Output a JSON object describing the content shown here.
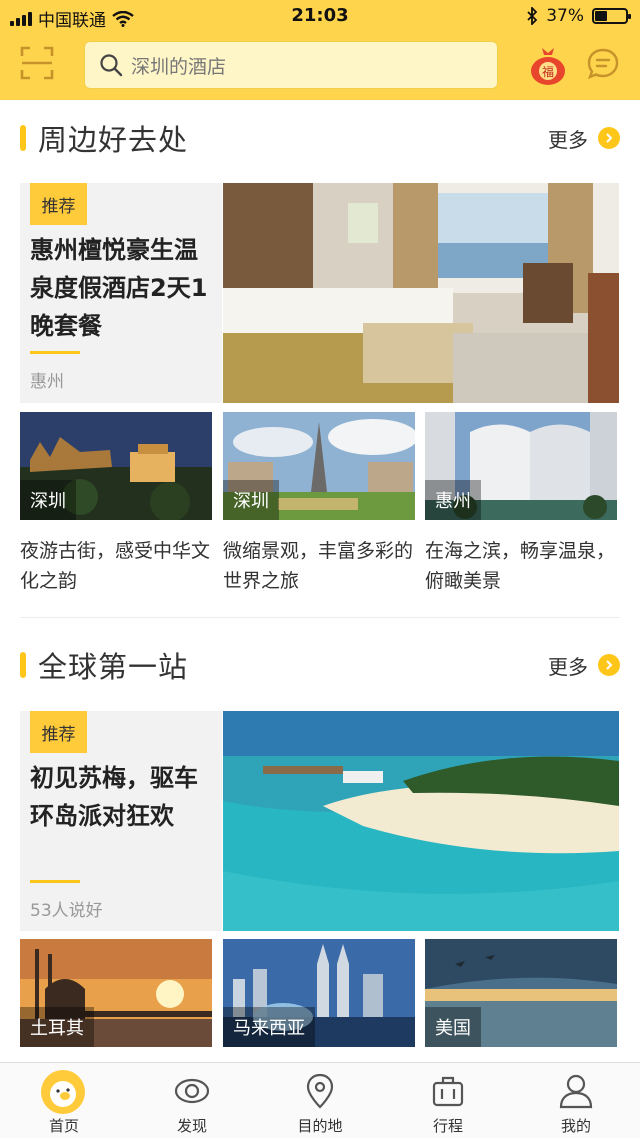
{
  "status_bar": {
    "carrier": "中国联通",
    "time": "21:03",
    "battery": "37%",
    "battery_level": 0.37
  },
  "search": {
    "placeholder": "深圳的酒店"
  },
  "badge": {
    "fu": "福"
  },
  "nearby": {
    "title": "周边好去处",
    "more": "更多",
    "feature": {
      "tag": "推荐",
      "title": "惠州檀悦豪生温泉度假酒店2天1晚套餐",
      "sub": "惠州"
    },
    "cards": [
      {
        "loc": "深圳",
        "desc": "夜游古街，感受中华文化之韵"
      },
      {
        "loc": "深圳",
        "desc": "微缩景观，丰富多彩的世界之旅"
      },
      {
        "loc": "惠州",
        "desc": "在海之滨，畅享温泉，俯瞰美景"
      }
    ]
  },
  "global": {
    "title": "全球第一站",
    "more": "更多",
    "feature": {
      "tag": "推荐",
      "title": "初见苏梅，驱车环岛派对狂欢",
      "sub": "53人说好"
    },
    "cards": [
      {
        "loc": "土耳其"
      },
      {
        "loc": "马来西亚"
      },
      {
        "loc": "美国"
      }
    ]
  },
  "tabs": [
    {
      "label": "首页",
      "icon": "home-pig-icon"
    },
    {
      "label": "发现",
      "icon": "eye-icon"
    },
    {
      "label": "目的地",
      "icon": "location-pin-icon"
    },
    {
      "label": "行程",
      "icon": "luggage-icon"
    },
    {
      "label": "我的",
      "icon": "user-icon"
    }
  ],
  "colors": {
    "brand_yellow": "#ffd44d",
    "accent": "#ffc61a"
  }
}
